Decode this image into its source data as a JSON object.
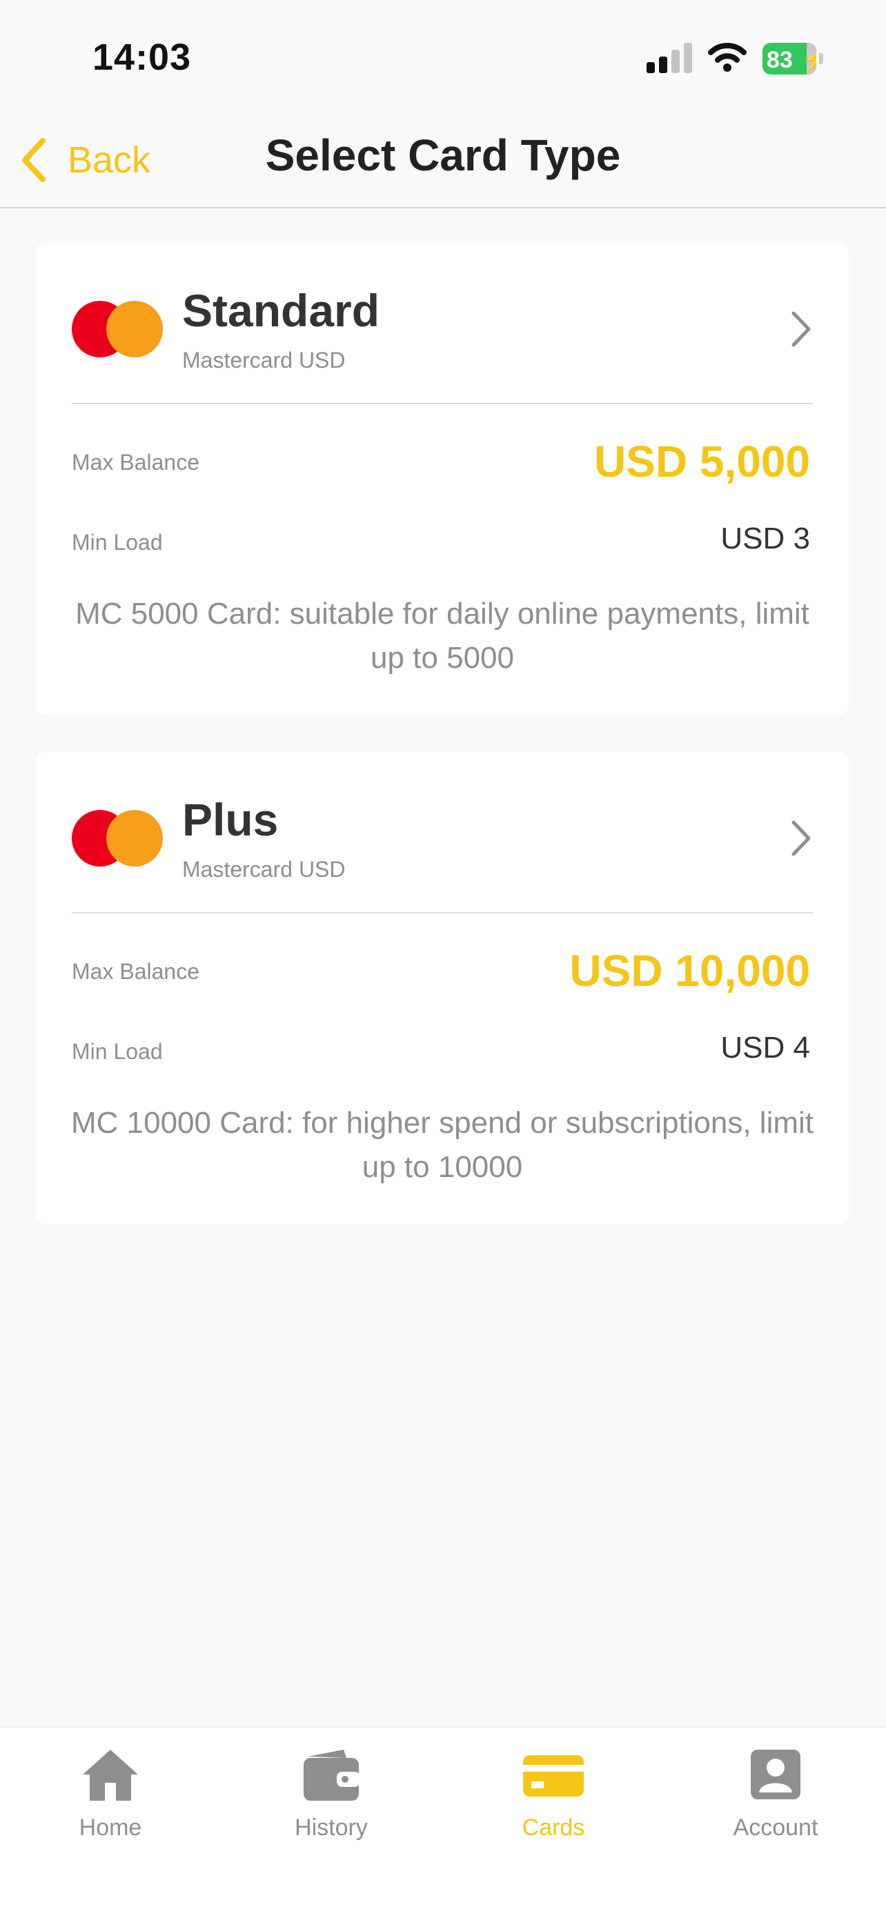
{
  "status_bar": {
    "time": "14:03",
    "battery_percent": "83"
  },
  "nav": {
    "back_label": "Back",
    "title": "Select Card Type"
  },
  "colors": {
    "accent": "#f5c518",
    "mastercard_red": "#eb001b",
    "mastercard_orange": "#f79e1b",
    "battery_green": "#34c759"
  },
  "cards": [
    {
      "name": "Standard",
      "subtitle": "Mastercard USD",
      "max_balance_label": "Max Balance",
      "max_balance": "USD 5,000",
      "min_load_label": "Min Load",
      "min_load": "USD 3",
      "description": "MC 5000 Card: suitable for daily online payments, limit up to 5000",
      "logo_icon": "mastercard-icon",
      "chevron_icon": "chevron-right-icon"
    },
    {
      "name": "Plus",
      "subtitle": "Mastercard USD",
      "max_balance_label": "Max Balance",
      "max_balance": "USD 10,000",
      "min_load_label": "Min Load",
      "min_load": "USD 4",
      "description": "MC 10000 Card: for higher spend or subscriptions, limit up to 10000",
      "logo_icon": "mastercard-icon",
      "chevron_icon": "chevron-right-icon"
    }
  ],
  "tab_bar": {
    "active": "Cards",
    "tabs": [
      {
        "label": "Home",
        "icon": "home-icon"
      },
      {
        "label": "History",
        "icon": "wallet-icon"
      },
      {
        "label": "Cards",
        "icon": "credit-card-icon"
      },
      {
        "label": "Account",
        "icon": "account-icon"
      }
    ]
  }
}
